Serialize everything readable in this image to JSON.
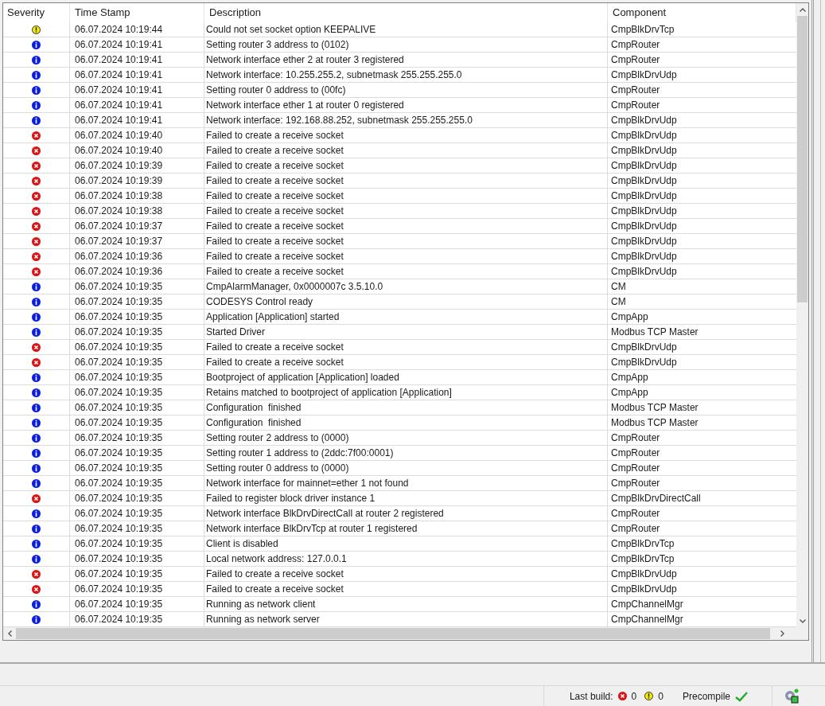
{
  "table": {
    "columns": [
      "Severity",
      "Time Stamp",
      "Description",
      "Component"
    ],
    "rows": [
      {
        "kind": "warning",
        "time": "06.07.2024 10:19:44",
        "description": "Could not set socket option KEEPALIVE",
        "component": "CmpBlkDrvTcp"
      },
      {
        "kind": "info",
        "time": "06.07.2024 10:19:41",
        "description": "Setting router 3 address to (0102)",
        "component": "CmpRouter"
      },
      {
        "kind": "info",
        "time": "06.07.2024 10:19:41",
        "description": "Network interface ether 2 at router 3 registered",
        "component": "CmpRouter"
      },
      {
        "kind": "info",
        "time": "06.07.2024 10:19:41",
        "description": "Network interface: 10.255.255.2, subnetmask 255.255.255.0",
        "component": "CmpBlkDrvUdp"
      },
      {
        "kind": "info",
        "time": "06.07.2024 10:19:41",
        "description": "Setting router 0 address to (00fc)",
        "component": "CmpRouter"
      },
      {
        "kind": "info",
        "time": "06.07.2024 10:19:41",
        "description": "Network interface ether 1 at router 0 registered",
        "component": "CmpRouter"
      },
      {
        "kind": "info",
        "time": "06.07.2024 10:19:41",
        "description": "Network interface: 192.168.88.252, subnetmask 255.255.255.0",
        "component": "CmpBlkDrvUdp"
      },
      {
        "kind": "error",
        "time": "06.07.2024 10:19:40",
        "description": "Failed to create a receive socket",
        "component": "CmpBlkDrvUdp"
      },
      {
        "kind": "error",
        "time": "06.07.2024 10:19:40",
        "description": "Failed to create a receive socket",
        "component": "CmpBlkDrvUdp"
      },
      {
        "kind": "error",
        "time": "06.07.2024 10:19:39",
        "description": "Failed to create a receive socket",
        "component": "CmpBlkDrvUdp"
      },
      {
        "kind": "error",
        "time": "06.07.2024 10:19:39",
        "description": "Failed to create a receive socket",
        "component": "CmpBlkDrvUdp"
      },
      {
        "kind": "error",
        "time": "06.07.2024 10:19:38",
        "description": "Failed to create a receive socket",
        "component": "CmpBlkDrvUdp"
      },
      {
        "kind": "error",
        "time": "06.07.2024 10:19:38",
        "description": "Failed to create a receive socket",
        "component": "CmpBlkDrvUdp"
      },
      {
        "kind": "error",
        "time": "06.07.2024 10:19:37",
        "description": "Failed to create a receive socket",
        "component": "CmpBlkDrvUdp"
      },
      {
        "kind": "error",
        "time": "06.07.2024 10:19:37",
        "description": "Failed to create a receive socket",
        "component": "CmpBlkDrvUdp"
      },
      {
        "kind": "error",
        "time": "06.07.2024 10:19:36",
        "description": "Failed to create a receive socket",
        "component": "CmpBlkDrvUdp"
      },
      {
        "kind": "error",
        "time": "06.07.2024 10:19:36",
        "description": "Failed to create a receive socket",
        "component": "CmpBlkDrvUdp"
      },
      {
        "kind": "info",
        "time": "06.07.2024 10:19:35",
        "description": "CmpAlarmManager, 0x0000007c 3.5.10.0",
        "component": "CM"
      },
      {
        "kind": "info",
        "time": "06.07.2024 10:19:35",
        "description": "CODESYS Control ready",
        "component": "CM"
      },
      {
        "kind": "info",
        "time": "06.07.2024 10:19:35",
        "description": "Application [Application] started",
        "component": "CmpApp"
      },
      {
        "kind": "info",
        "time": "06.07.2024 10:19:35",
        "description": "Started Driver",
        "component": "Modbus TCP Master"
      },
      {
        "kind": "error",
        "time": "06.07.2024 10:19:35",
        "description": "Failed to create a receive socket",
        "component": "CmpBlkDrvUdp"
      },
      {
        "kind": "error",
        "time": "06.07.2024 10:19:35",
        "description": "Failed to create a receive socket",
        "component": "CmpBlkDrvUdp"
      },
      {
        "kind": "info",
        "time": "06.07.2024 10:19:35",
        "description": "Bootproject of application [Application] loaded",
        "component": "CmpApp"
      },
      {
        "kind": "info",
        "time": "06.07.2024 10:19:35",
        "description": "Retains matched to bootproject of application [Application]",
        "component": "CmpApp"
      },
      {
        "kind": "info",
        "time": "06.07.2024 10:19:35",
        "description": "Configuration  finished",
        "component": "Modbus TCP Master"
      },
      {
        "kind": "info",
        "time": "06.07.2024 10:19:35",
        "description": "Configuration  finished",
        "component": "Modbus TCP Master"
      },
      {
        "kind": "info",
        "time": "06.07.2024 10:19:35",
        "description": "Setting router 2 address to (0000)",
        "component": "CmpRouter"
      },
      {
        "kind": "info",
        "time": "06.07.2024 10:19:35",
        "description": "Setting router 1 address to (2ddc:7f00:0001)",
        "component": "CmpRouter"
      },
      {
        "kind": "info",
        "time": "06.07.2024 10:19:35",
        "description": "Setting router 0 address to (0000)",
        "component": "CmpRouter"
      },
      {
        "kind": "info",
        "time": "06.07.2024 10:19:35",
        "description": "Network interface for mainnet=ether 1 not found",
        "component": "CmpRouter"
      },
      {
        "kind": "error",
        "time": "06.07.2024 10:19:35",
        "description": "Failed to register block driver instance 1",
        "component": "CmpBlkDrvDirectCall"
      },
      {
        "kind": "info",
        "time": "06.07.2024 10:19:35",
        "description": "Network interface BlkDrvDirectCall at router 2 registered",
        "component": "CmpRouter"
      },
      {
        "kind": "info",
        "time": "06.07.2024 10:19:35",
        "description": "Network interface BlkDrvTcp at router 1 registered",
        "component": "CmpRouter"
      },
      {
        "kind": "info",
        "time": "06.07.2024 10:19:35",
        "description": "Client is disabled",
        "component": "CmpBlkDrvTcp"
      },
      {
        "kind": "info",
        "time": "06.07.2024 10:19:35",
        "description": "Local network address: 127.0.0.1",
        "component": "CmpBlkDrvTcp"
      },
      {
        "kind": "error",
        "time": "06.07.2024 10:19:35",
        "description": "Failed to create a receive socket",
        "component": "CmpBlkDrvUdp"
      },
      {
        "kind": "error",
        "time": "06.07.2024 10:19:35",
        "description": "Failed to create a receive socket",
        "component": "CmpBlkDrvUdp"
      },
      {
        "kind": "info",
        "time": "06.07.2024 10:19:35",
        "description": "Running as network client",
        "component": "CmpChannelMgr"
      },
      {
        "kind": "info",
        "time": "06.07.2024 10:19:35",
        "description": "Running as network server",
        "component": "CmpChannelMgr"
      }
    ]
  },
  "status_bar": {
    "last_build_label": "Last build:",
    "errors": "0",
    "warnings": "0",
    "precompile_label": "Precompile",
    "precompile_ok": true
  }
}
